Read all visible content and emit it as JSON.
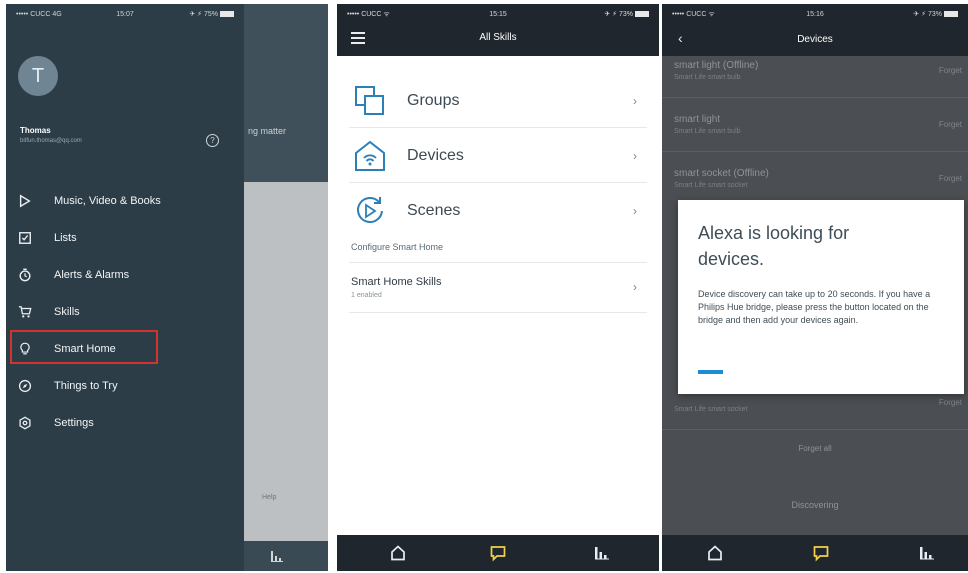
{
  "panel1": {
    "status": {
      "carrier": "••••• CUCC 4G",
      "time": "15:07",
      "right": "✈ ⚡ 75%"
    },
    "behind": {
      "peek_text": "ng matter",
      "peek_bottom": "Help"
    },
    "profile": {
      "initial": "T",
      "name": "Thomas",
      "email": "bitfun.thomas@qq.com"
    },
    "menu": [
      {
        "label": "Music, Video & Books",
        "icon": "play-icon"
      },
      {
        "label": "Lists",
        "icon": "checkbox-icon"
      },
      {
        "label": "Alerts & Alarms",
        "icon": "timer-icon"
      },
      {
        "label": "Skills",
        "icon": "cart-icon"
      },
      {
        "label": "Smart Home",
        "icon": "lightbulb-icon"
      },
      {
        "label": "Things to Try",
        "icon": "compass-icon"
      },
      {
        "label": "Settings",
        "icon": "gear-icon"
      }
    ]
  },
  "panel2": {
    "status": {
      "carrier": "••••• CUCC ᯤ",
      "time": "15:15",
      "right": "✈ ⚡ 73%"
    },
    "title": "All Skills",
    "rows": [
      {
        "label": "Groups",
        "icon": "groups-icon"
      },
      {
        "label": "Devices",
        "icon": "devices-icon"
      },
      {
        "label": "Scenes",
        "icon": "scenes-icon"
      }
    ],
    "configure_label": "Configure Smart Home",
    "smart_home_skills": {
      "label": "Smart Home Skills",
      "sub": "1 enabled"
    }
  },
  "panel3": {
    "status": {
      "carrier": "••••• CUCC ᯤ",
      "time": "15:16",
      "right": "✈ ⚡ 73%"
    },
    "title": "Devices",
    "devices": [
      {
        "name": "smart light (Offline)",
        "sub": "Smart Life smart bulb",
        "action": "Forget"
      },
      {
        "name": "smart light",
        "sub": "Smart Life smart bulb",
        "action": "Forget"
      },
      {
        "name": "smart socket (Offline)",
        "sub": "Smart Life smart socket",
        "action": "Forget"
      },
      {
        "name": "",
        "sub": "Smart Life smart socket",
        "action": "Forget"
      }
    ],
    "forget_all": "Forget all",
    "discover": "Discovering",
    "modal": {
      "title": "Alexa is looking for devices.",
      "text": "Device discovery can take up to 20 seconds. If you have a Philips Hue bridge, please press the button located on the bridge and then add your devices again.",
      "progress": 0.1
    }
  },
  "colors": {
    "drawer": "#2d3d47",
    "highlight": "#d0342c",
    "accent": "#1f8ad6",
    "bar": "#1f262d"
  }
}
